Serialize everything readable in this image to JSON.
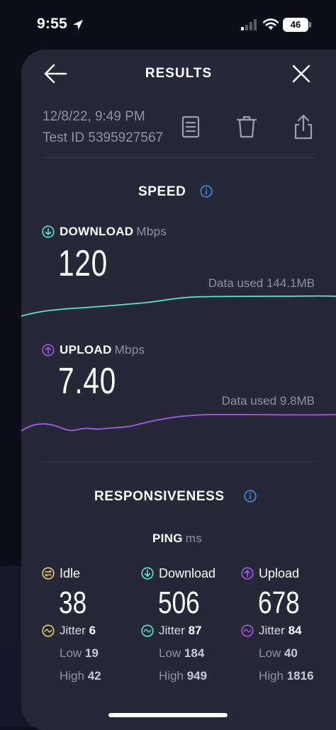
{
  "status_bar": {
    "time": "9:55",
    "battery": "46"
  },
  "header": {
    "title": "RESULTS"
  },
  "meta": {
    "date": "12/8/22, 9:49 PM",
    "test_id": "Test ID 5395927567"
  },
  "speed": {
    "title": "SPEED",
    "download": {
      "label": "DOWNLOAD",
      "unit": "Mbps",
      "value": "120",
      "data_used": "Data used 144.1MB",
      "color": "#5fe2d2"
    },
    "upload": {
      "label": "UPLOAD",
      "unit": "Mbps",
      "value": "7.40",
      "data_used": "Data used 9.8MB",
      "color": "#a05ce8"
    }
  },
  "responsiveness": {
    "title": "RESPONSIVENESS",
    "ping_label": "PING",
    "ping_unit": "ms",
    "columns": [
      {
        "label": "Idle",
        "value": "38",
        "jitter_label": "Jitter",
        "jitter": "6",
        "low_label": "Low",
        "low": "19",
        "high_label": "High",
        "high": "42",
        "color": "#e9d36a"
      },
      {
        "label": "Download",
        "value": "506",
        "jitter_label": "Jitter",
        "jitter": "87",
        "low_label": "Low",
        "low": "184",
        "high_label": "High",
        "high": "949",
        "color": "#5fe2d2"
      },
      {
        "label": "Upload",
        "value": "678",
        "jitter_label": "Jitter",
        "jitter": "84",
        "low_label": "Low",
        "low": "40",
        "high_label": "High",
        "high": "1816",
        "color": "#a05ce8"
      }
    ]
  },
  "colors": {
    "sheet_bg": "#262838",
    "info_icon": "#3f8de0",
    "muted_text": "#8f92a6"
  }
}
